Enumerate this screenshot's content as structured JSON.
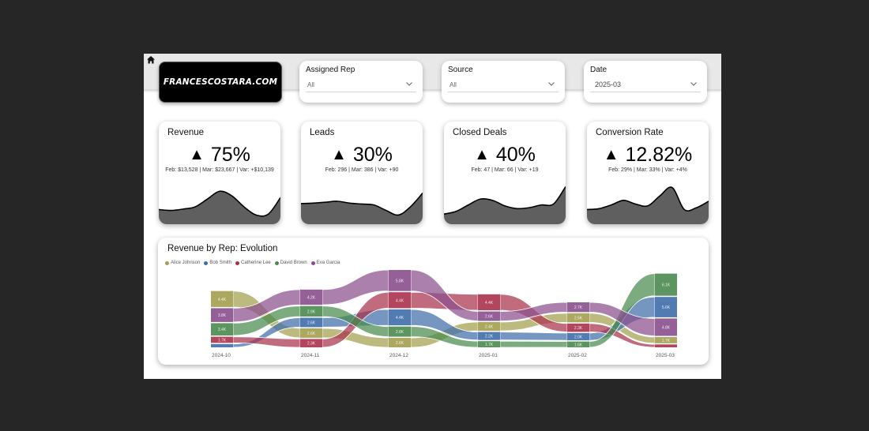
{
  "brand": {
    "logo_text": "FRANCESCOSTARA.COM"
  },
  "filters": [
    {
      "title": "Assigned Rep",
      "value": "All"
    },
    {
      "title": "Source",
      "value": "All"
    },
    {
      "title": "Date",
      "value": "2025-03"
    }
  ],
  "kpis": [
    {
      "title": "Revenue",
      "arrow": "▲",
      "value": "75%",
      "sub": "Feb: $13,528 | Mar: $23,667 | Var: +$10,139"
    },
    {
      "title": "Leads",
      "arrow": "▲",
      "value": "30%",
      "sub": "Feb: 296 | Mar: 386 | Var: +90"
    },
    {
      "title": "Closed Deals",
      "arrow": "▲",
      "value": "40%",
      "sub": "Feb: 47 | Mar: 66 | Var: +19"
    },
    {
      "title": "Conversion Rate",
      "arrow": "▲",
      "value": "12.82%",
      "sub": "Feb: 29% | Mar: 33% | Var: +4%"
    }
  ],
  "chart_data": {
    "type": "ribbon",
    "title": "Revenue by Rep: Evolution",
    "categories": [
      "2024-10",
      "2024-11",
      "2024-12",
      "2025-01",
      "2025-02",
      "2025-03"
    ],
    "series": [
      {
        "name": "Alice Johnson",
        "color": "#a39f4e",
        "values": [
          4.4,
          2.6,
          2.6,
          2.4,
          2.5,
          1.7
        ]
      },
      {
        "name": "Bob Smith",
        "color": "#3f6ea8",
        "values": [
          0.9,
          2.6,
          4.4,
          2.2,
          2.0,
          5.6
        ]
      },
      {
        "name": "Catherine Lee",
        "color": "#a9324c",
        "values": [
          1.7,
          2.3,
          4.4,
          4.4,
          2.3,
          0.8
        ]
      },
      {
        "name": "David Brown",
        "color": "#4a8a4e",
        "values": [
          3.4,
          2.9,
          2.8,
          1.7,
          1.6,
          6.1
        ]
      },
      {
        "name": "Eva Garcia",
        "color": "#8a4f8d",
        "values": [
          3.8,
          4.2,
          5.8,
          2.6,
          2.7,
          4.8
        ]
      }
    ],
    "band_labels": [
      [
        "4.4K",
        "0.9K",
        "1.7K",
        "3.4K",
        "3.8K"
      ],
      [
        "2.6K",
        "2.6K",
        "2.3K",
        "2.9K",
        "4.2K"
      ],
      [
        "2.6K",
        "4.4K",
        "4.4K",
        "2.8K",
        "5.8K"
      ],
      [
        "2.4K",
        "2.2K",
        "4.4K",
        "1.7K",
        "2.6K"
      ],
      [
        "2.5K",
        "2.0K",
        "2.3K",
        "1.6K",
        "2.7K"
      ],
      [
        "1.7K",
        "5.6K",
        "0.8K",
        "6.1K",
        "4.8K"
      ]
    ]
  },
  "sparklines": [
    [
      0.32,
      0.3,
      0.33,
      0.38,
      0.55,
      0.72,
      0.62,
      0.38,
      0.2,
      0.22,
      0.58
    ],
    [
      0.45,
      0.46,
      0.48,
      0.5,
      0.46,
      0.44,
      0.42,
      0.3,
      0.2,
      0.38,
      0.68
    ],
    [
      0.22,
      0.28,
      0.42,
      0.55,
      0.52,
      0.4,
      0.34,
      0.36,
      0.42,
      0.44,
      0.82
    ],
    [
      0.32,
      0.34,
      0.42,
      0.52,
      0.44,
      0.4,
      0.62,
      0.8,
      0.32,
      0.36,
      0.5
    ]
  ]
}
